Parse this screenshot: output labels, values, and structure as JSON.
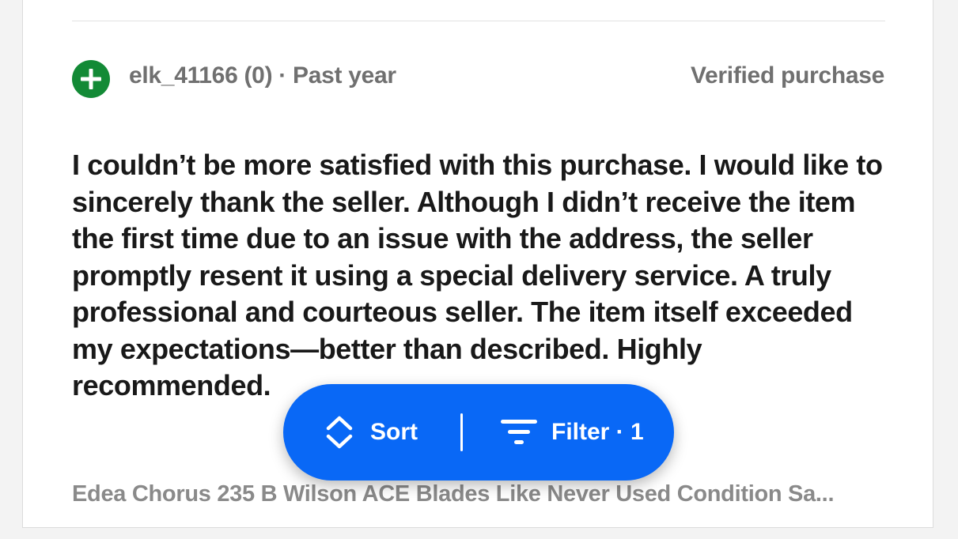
{
  "review": {
    "avatar_icon": "plus-icon",
    "avatar_color": "#138a36",
    "meta": "elk_41166 (0) · Past year",
    "badge": "Verified purchase",
    "text": "I couldn’t be more satisfied with this purchase. I would like to sincerely thank the seller. Although I didn’t receive the item the first time due to an issue with the address, the seller promptly resent it using a special delivery service. A truly professional and courteous seller. The item itself exceeded my expectations—better than described. Highly recommended.",
    "product": "Edea Chorus 235 B Wilson ACE Blades Like Never Used Condition Sa..."
  },
  "toolbar": {
    "sort_icon": "sort-chevrons-icon",
    "sort_label": "Sort",
    "filter_icon": "filter-funnel-icon",
    "filter_label": "Filter · 1",
    "accent": "#0968f6"
  }
}
